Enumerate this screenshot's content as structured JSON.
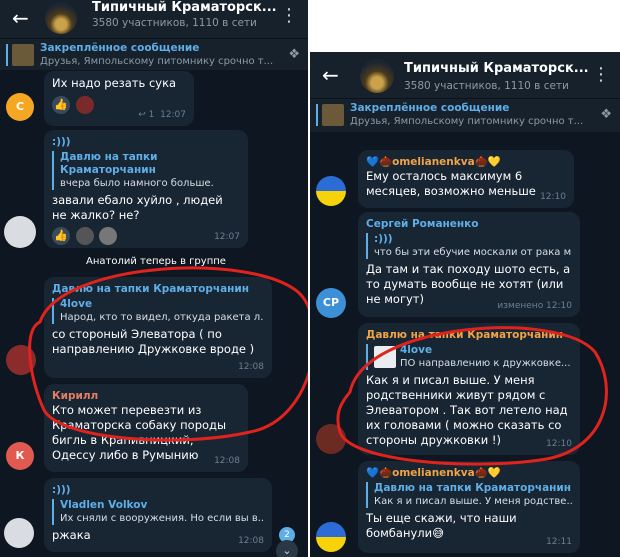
{
  "left": {
    "header": {
      "back_icon": "arrow-left-icon",
      "title": "Типичный Краматорск...",
      "subtitle": "3580 участников, 1110 в сети"
    },
    "pinned": {
      "title": "Закреплённое сообщение",
      "text": "Друзья, Ямпольскому питомнику срочно т..."
    },
    "messages": [
      {
        "text": "Их надо резать сука",
        "reply_count": "1",
        "time": "12:07",
        "avatar_letter": "С",
        "avatar_color": "#f5a623"
      },
      {
        "sender_color": "#5eaee8",
        "sender": ":)))",
        "quote_name": "Давлю на тапки Краматорчанин",
        "quote_text": "вчера было намного больше.",
        "text": "завали ебало хуйло , людей не жалко? не?",
        "time": "12:07"
      },
      {
        "sender": "Давлю на тапки Краматорчанин",
        "sender_color": "#5eaee8",
        "quote_name": "4love",
        "quote_text": "Народ, кто то видел, откуда ракета л...",
        "text": "со стороный Элеватора ( по направлению Дружковке вроде )",
        "time": "12:08"
      },
      {
        "sender": "Кирилл",
        "sender_color": "#e57f63",
        "text": "Кто может перевезти из Краматорска собаку породы бигль в Крапивницкий, Одессу либо в Румынию",
        "time": "12:08",
        "avatar_letter": "К",
        "avatar_color": "#e15a4f"
      },
      {
        "sender": ":)))",
        "sender_color": "#5eaee8",
        "quote_name": "Vladlen Volkov",
        "quote_text": "Их сняли с вооружения. Но если вы в...",
        "text": "ржака",
        "time": "12:08"
      }
    ],
    "service_text": "Анатолий теперь в группе",
    "unread_badge": "2"
  },
  "right": {
    "header": {
      "back_icon": "arrow-left-icon",
      "title": "Типичный Краматорск...",
      "subtitle": "3580 участников, 1110 в сети"
    },
    "pinned": {
      "title": "Закреплённое сообщение",
      "text": "Друзья, Ямпольскому питомнику срочно т..."
    },
    "messages": [
      {
        "sender": "💙🌰omelianenkva🌰💛",
        "sender_color": "#f0a347",
        "text": "Ему осталось максимум 6 месяцев, возможно меньше",
        "time": "12:10"
      },
      {
        "sender": "Сергей Романенко",
        "sender_color": "#5eaee8",
        "quote_name": ":)))",
        "quote_text": "что бы эти ебучие москали от рака м...",
        "text": "Да там и так походу шото есть, а то думать вообще не хотят (или не могут)",
        "time": "изменено 12:10",
        "avatar_letter": "СР",
        "avatar_color": "#3d8fd6"
      },
      {
        "sender": "Давлю на тапки Краматорчанин",
        "sender_color": "#f0a347",
        "quote_name": "4love",
        "quote_text": "ПО направлению к дружковке...",
        "text": "Как я и писал выше. У меня родственники живут рядом с Элеватором . Так вот летело над их головами ( можно сказать со стороны дружковки !)",
        "time": "12:10"
      },
      {
        "sender": "💙🌰omelianenkva🌰💛",
        "sender_color": "#f0a347",
        "quote_name": "Давлю на тапки Краматорчанин",
        "quote_text": "Как я и писал выше. У меня родстве...",
        "text": "Ты еще скажи, что наши бомбанули😅",
        "time": "12:11"
      }
    ]
  },
  "colors": {
    "chat_bg": "#0e1621",
    "bubble": "#182533",
    "accent": "#5eaee8",
    "annotation": "#e0231c"
  }
}
